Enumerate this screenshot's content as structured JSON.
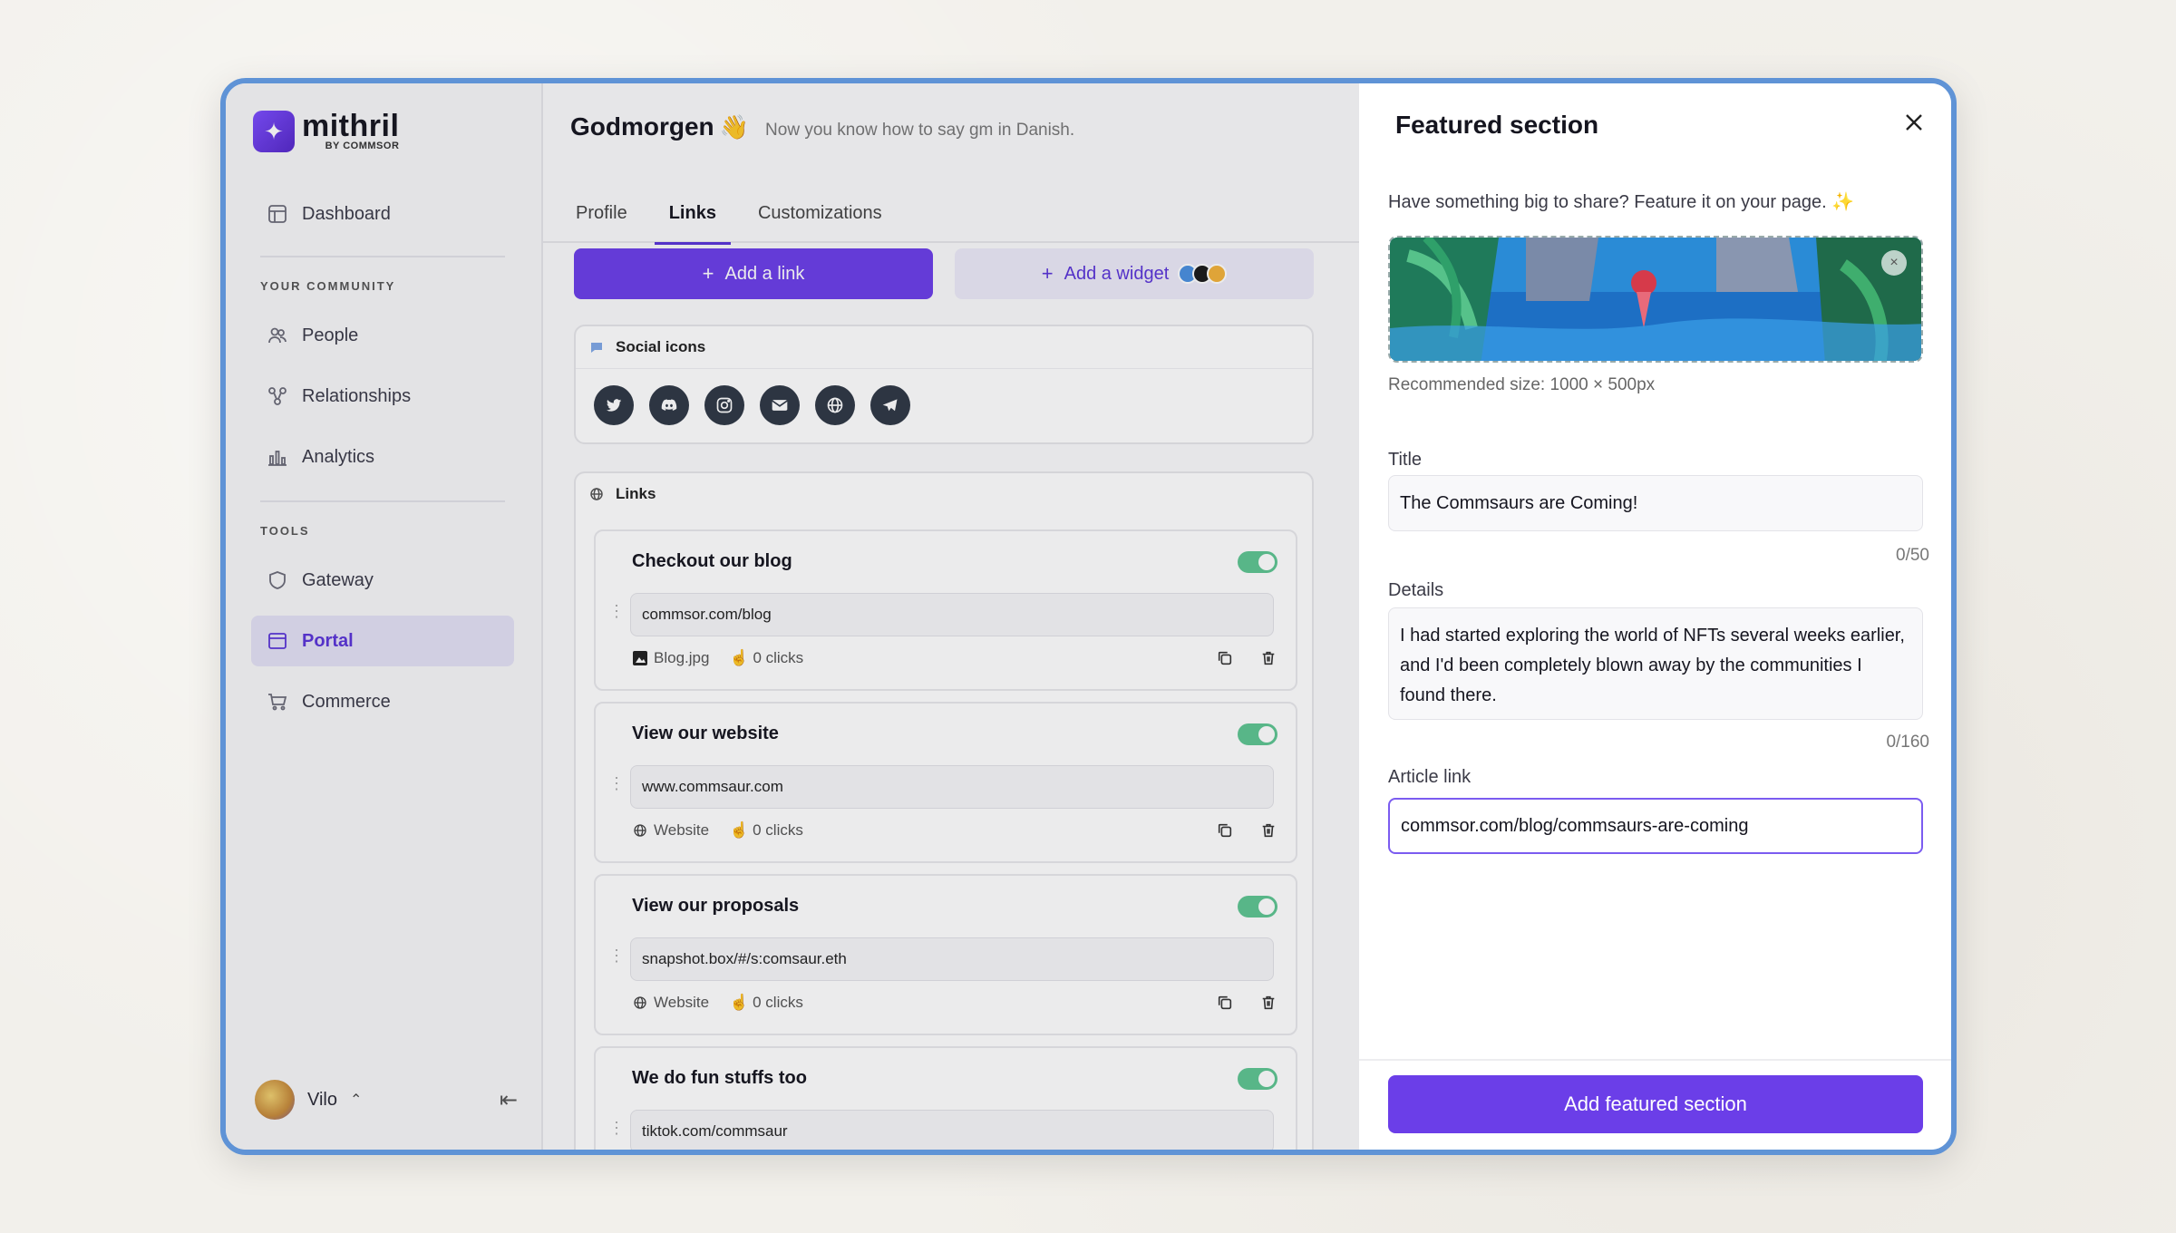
{
  "brand": {
    "name": "mithril",
    "sub": "BY COMMSOR"
  },
  "sidebar": {
    "dashboard": "Dashboard",
    "section_community": "YOUR COMMUNITY",
    "people": "People",
    "relationships": "Relationships",
    "analytics": "Analytics",
    "section_tools": "TOOLS",
    "gateway": "Gateway",
    "portal": "Portal",
    "commerce": "Commerce",
    "user_name": "Vilo"
  },
  "header": {
    "title": "Godmorgen",
    "emoji": "👋",
    "subtitle": "Now you know how to say gm in Danish."
  },
  "tabs": [
    "Profile",
    "Links",
    "Customizations"
  ],
  "actions": {
    "add_link": "Add a link",
    "add_widget": "Add a widget"
  },
  "social": {
    "title": "Social icons",
    "icons": [
      "twitter-icon",
      "discord-icon",
      "instagram-icon",
      "email-icon",
      "globe-icon",
      "telegram-icon"
    ]
  },
  "links": {
    "title": "Links",
    "items": [
      {
        "title": "Checkout our blog",
        "url": "commsor.com/blog",
        "type": "Blog.jpg",
        "clicks": "0 clicks",
        "enabled": true
      },
      {
        "title": "View our website",
        "url": "www.commsaur.com",
        "type": "Website",
        "clicks": "0 clicks",
        "enabled": true
      },
      {
        "title": "View our proposals",
        "url": "snapshot.box/#/s:comsaur.eth",
        "type": "Website",
        "clicks": "0 clicks",
        "enabled": true
      },
      {
        "title": "We do fun stuffs too",
        "url": "tiktok.com/commsaur",
        "type": "",
        "clicks": "",
        "enabled": true
      }
    ]
  },
  "panel": {
    "title": "Featured section",
    "intro": "Have something big to share? Feature it on your page.",
    "intro_emoji": "✨",
    "recommended": "Recommended size: 1000 × 500px",
    "title_label": "Title",
    "title_value": "The Commsaurs are Coming!",
    "title_count": "0/50",
    "details_label": "Details",
    "details_value": "I had started exploring the world of NFTs several weeks earlier, and I'd been completely blown away by the communities I found there.",
    "details_count": "0/160",
    "article_label": "Article link",
    "article_value": "commsor.com/blog/commsaurs-are-coming",
    "submit": "Add featured section"
  },
  "colors": {
    "accent": "#6b3ee8",
    "toggle_on": "#5ec592",
    "frame": "#5f93d6"
  }
}
